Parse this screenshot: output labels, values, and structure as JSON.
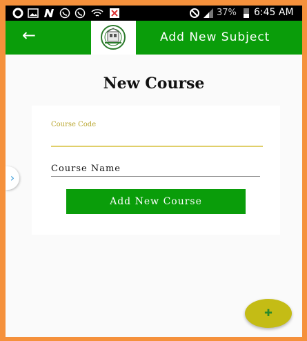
{
  "status_bar": {
    "battery_percent": "37%",
    "time": "6:45 AM"
  },
  "app_bar": {
    "title": "Add New Subject",
    "back_icon": "arrow-left-icon"
  },
  "main": {
    "heading": "New Course",
    "course_code": {
      "label": "Course Code",
      "value": ""
    },
    "course_name": {
      "placeholder": "Course Name",
      "value": ""
    },
    "add_button": "Add New Course"
  },
  "colors": {
    "primary": "#0a9d0a",
    "accent": "#c4bc15",
    "frame": "#f5913c"
  }
}
